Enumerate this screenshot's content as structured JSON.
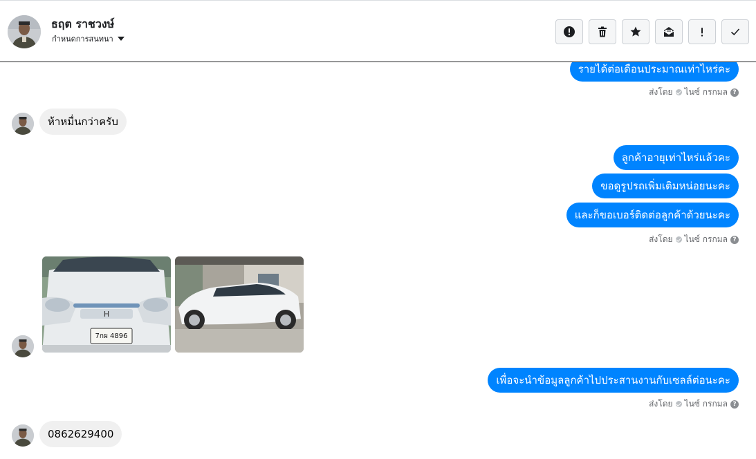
{
  "header": {
    "contact_name": "ธฤต ราชวงษ์",
    "assign_label": "กำหนดการสนทนา"
  },
  "actions": [
    {
      "name": "spam-button",
      "icon": "alert-circle-icon"
    },
    {
      "name": "delete-button",
      "icon": "trash-icon"
    },
    {
      "name": "star-button",
      "icon": "star-icon"
    },
    {
      "name": "mark-unread-button",
      "icon": "envelope-open-icon"
    },
    {
      "name": "follow-up-button",
      "icon": "exclamation-icon"
    },
    {
      "name": "mark-done-button",
      "icon": "check-icon"
    }
  ],
  "messages": {
    "out_1": "รายได้ต่อเดือนประมาณเท่าไหร่คะ",
    "in_1": "ห้าหมื่นกว่าครับ",
    "out_2": "ลูกค้าอายุเท่าไหร่แล้วคะ",
    "out_3": "ขอดูรูปรถเพิ่มเติมหน่อยนะคะ",
    "out_4": "และก็ขอเบอร์ติดต่อลูกค้าด้วยนะคะ",
    "out_5": "เพื่อจะนำข้อมูลลูกค้าไปประสานงานกับเซลล์ต่อนะคะ",
    "in_2": "0862629400"
  },
  "sent_info": {
    "prefix": "ส่งโดย",
    "sender": "ไนซ์ กรกมล"
  },
  "photos": {
    "plate_text": "7กผ 4896"
  },
  "colors": {
    "outgoing_bubble": "#0084ff",
    "incoming_bubble": "#f0f0f0"
  }
}
